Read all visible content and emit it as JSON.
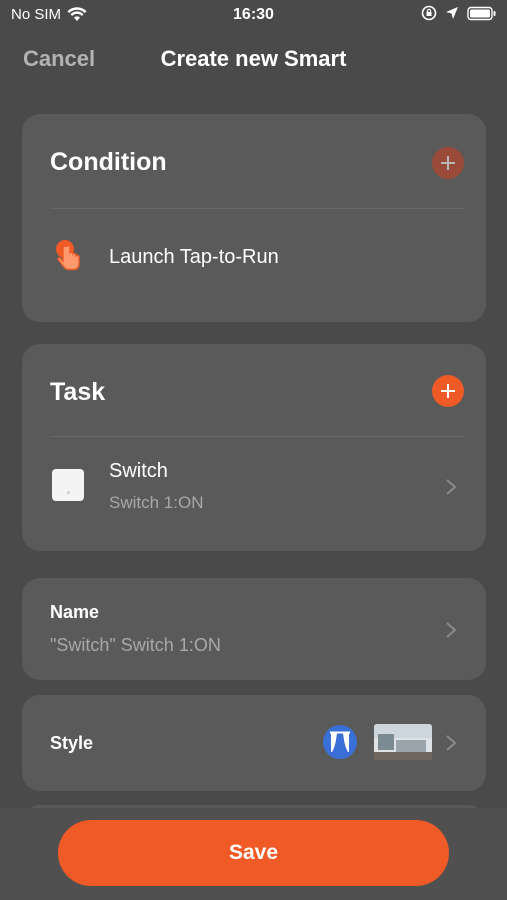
{
  "status_bar": {
    "carrier": "No SIM",
    "time": "16:30"
  },
  "nav": {
    "cancel_label": "Cancel",
    "title": "Create new Smart"
  },
  "condition": {
    "header": "Condition",
    "items": [
      {
        "label": "Launch Tap-to-Run",
        "icon": "tap-hand-icon"
      }
    ]
  },
  "task": {
    "header": "Task",
    "items": [
      {
        "title": "Switch",
        "detail": "Switch 1:ON",
        "icon": "switch-device-icon"
      }
    ]
  },
  "name": {
    "label": "Name",
    "value": "\"Switch\" Switch 1:ON"
  },
  "style": {
    "label": "Style",
    "icon": "curtain-icon",
    "thumbnail": "room-photo-thumbnail"
  },
  "save_label": "Save",
  "colors": {
    "background": "#4a4a4a",
    "card": "#5a5a5a",
    "accent": "#f05a26",
    "muted_text": "#a8a8a8"
  }
}
